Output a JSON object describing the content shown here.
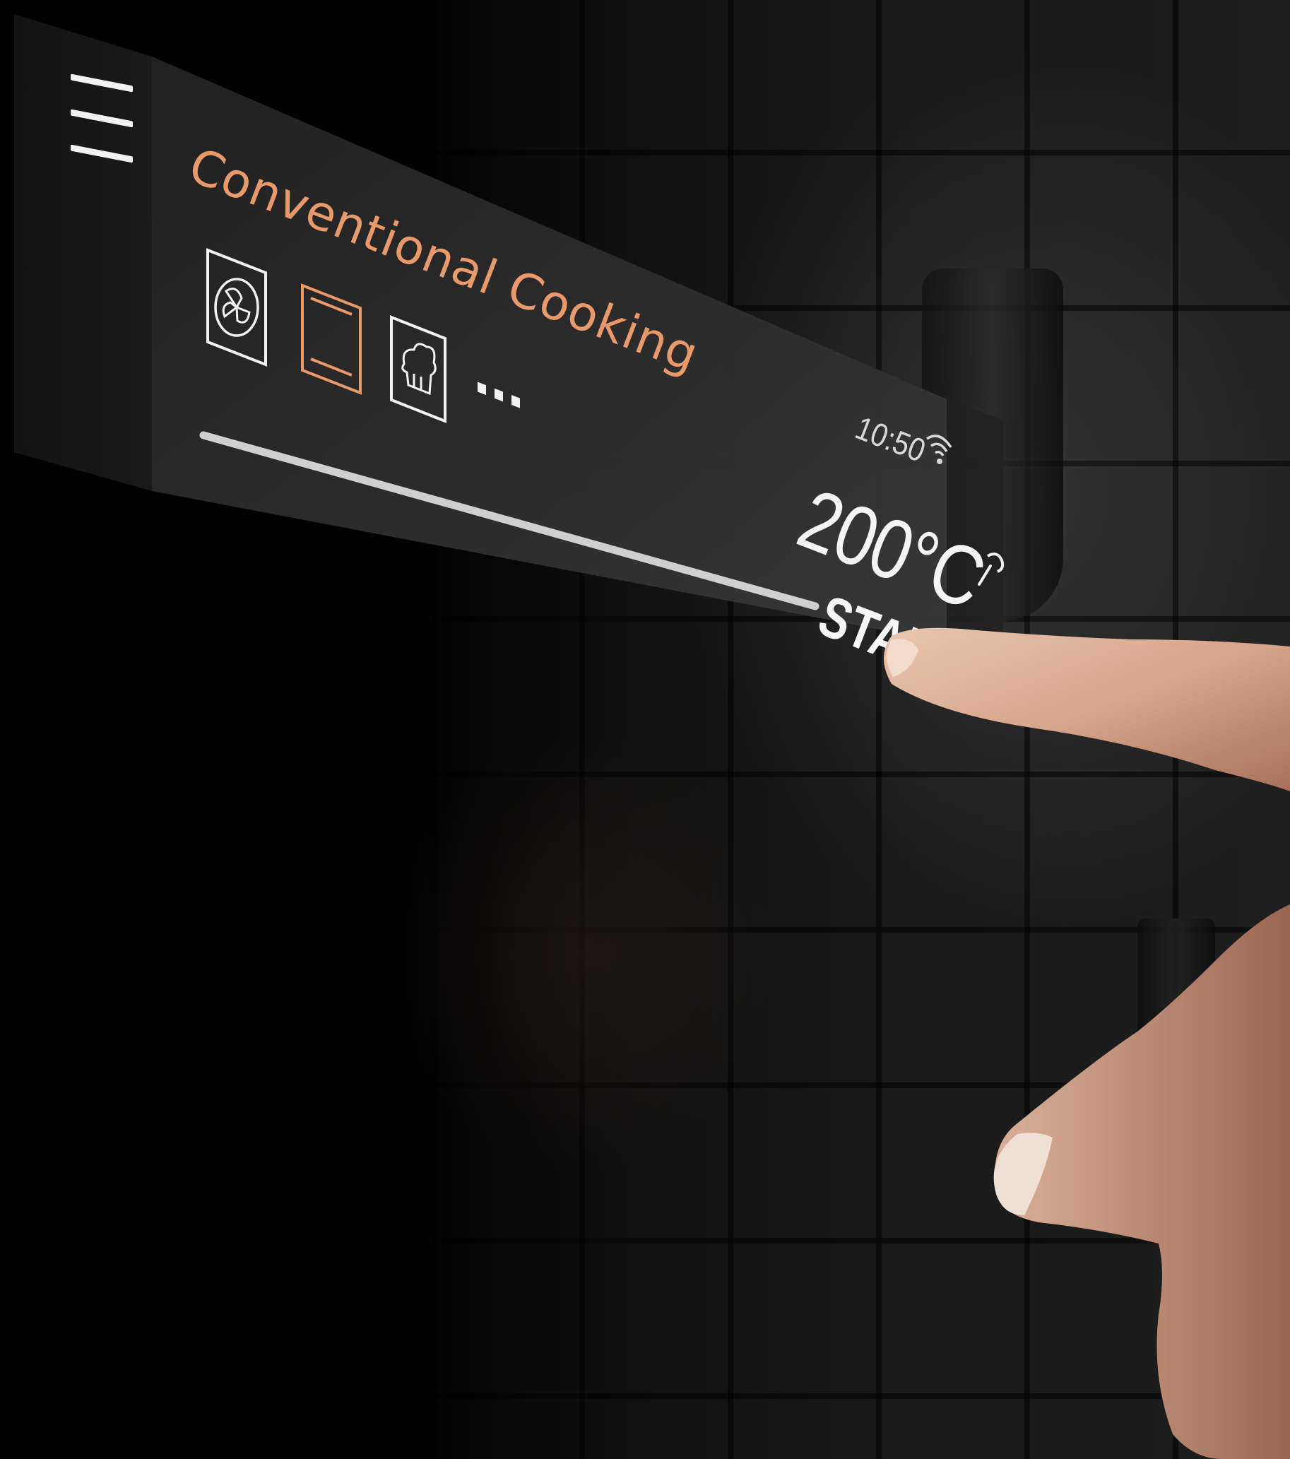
{
  "display": {
    "program_title": "Conventional Cooking",
    "more_label": "...",
    "time": "10:50",
    "temperature": "200°C",
    "start_label": "START"
  },
  "modes": [
    {
      "icon": "fan-icon",
      "selected": false
    },
    {
      "icon": "conventional-heat-icon",
      "selected": true
    },
    {
      "icon": "steam-icon",
      "selected": false
    }
  ],
  "colors": {
    "accent": "#e89a6a",
    "text": "#f4f4f4",
    "panel": "#2b2b2b",
    "progress": "#cfcfcf"
  },
  "icons": {
    "menu": "hamburger-menu-icon",
    "wifi": "wifi-icon",
    "side": "food-probe-icon"
  }
}
